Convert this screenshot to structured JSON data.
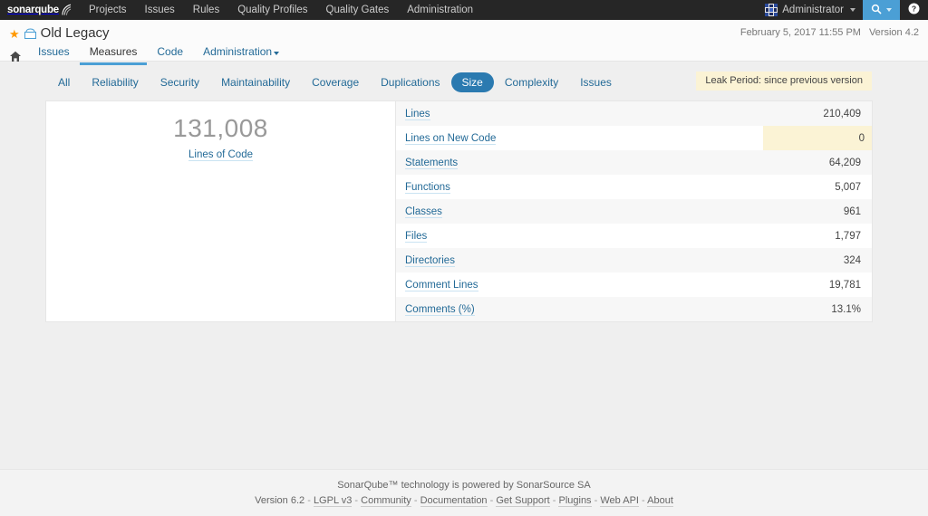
{
  "global_nav": {
    "brand": "sonarqube",
    "menu": [
      {
        "label": "Projects"
      },
      {
        "label": "Issues"
      },
      {
        "label": "Rules"
      },
      {
        "label": "Quality Profiles"
      },
      {
        "label": "Quality Gates"
      },
      {
        "label": "Administration"
      }
    ],
    "user": "Administrator",
    "search_icon": "search-icon",
    "help_icon": "help-icon"
  },
  "context": {
    "project_name": "Old Legacy",
    "favorite_icon": "star-icon",
    "qualifier_icon": "project-icon",
    "analysis_date": "February 5, 2017 11:55 PM",
    "project_version": "Version 4.2",
    "tabs": [
      {
        "label": "Issues",
        "active": false
      },
      {
        "label": "Measures",
        "active": true
      },
      {
        "label": "Code",
        "active": false
      },
      {
        "label": "Administration",
        "active": false,
        "has_caret": true
      }
    ]
  },
  "measures_nav": {
    "domains": [
      {
        "label": "All",
        "selected": false
      },
      {
        "label": "Reliability",
        "selected": false
      },
      {
        "label": "Security",
        "selected": false
      },
      {
        "label": "Maintainability",
        "selected": false
      },
      {
        "label": "Coverage",
        "selected": false
      },
      {
        "label": "Duplications",
        "selected": false
      },
      {
        "label": "Size",
        "selected": true
      },
      {
        "label": "Complexity",
        "selected": false
      },
      {
        "label": "Issues",
        "selected": false
      }
    ],
    "leak_period": "Leak Period: since previous version"
  },
  "overview": {
    "big_value": "131,008",
    "big_label": "Lines of Code"
  },
  "measures_table": {
    "rows": [
      {
        "name": "Lines",
        "value": "210,409",
        "leak": false
      },
      {
        "name": "Lines on New Code",
        "value": "0",
        "leak": true
      },
      {
        "name": "Statements",
        "value": "64,209",
        "leak": false
      },
      {
        "name": "Functions",
        "value": "5,007",
        "leak": false
      },
      {
        "name": "Classes",
        "value": "961",
        "leak": false
      },
      {
        "name": "Files",
        "value": "1,797",
        "leak": false
      },
      {
        "name": "Directories",
        "value": "324",
        "leak": false
      },
      {
        "name": "Comment Lines",
        "value": "19,781",
        "leak": false
      },
      {
        "name": "Comments (%)",
        "value": "13.1%",
        "leak": false
      }
    ]
  },
  "footer": {
    "tagline": "SonarQube™ technology is powered by SonarSource SA",
    "version": "Version 6.2",
    "links": [
      {
        "label": "LGPL v3"
      },
      {
        "label": "Community"
      },
      {
        "label": "Documentation"
      },
      {
        "label": "Get Support"
      },
      {
        "label": "Plugins"
      },
      {
        "label": "Web API"
      },
      {
        "label": "About"
      }
    ]
  },
  "colors": {
    "navbar_bg": "#262626",
    "accent_blue": "#4b9fd5",
    "link_blue": "#236a97",
    "leak_yellow": "#fbf3d5",
    "star_orange": "#ff9900"
  }
}
